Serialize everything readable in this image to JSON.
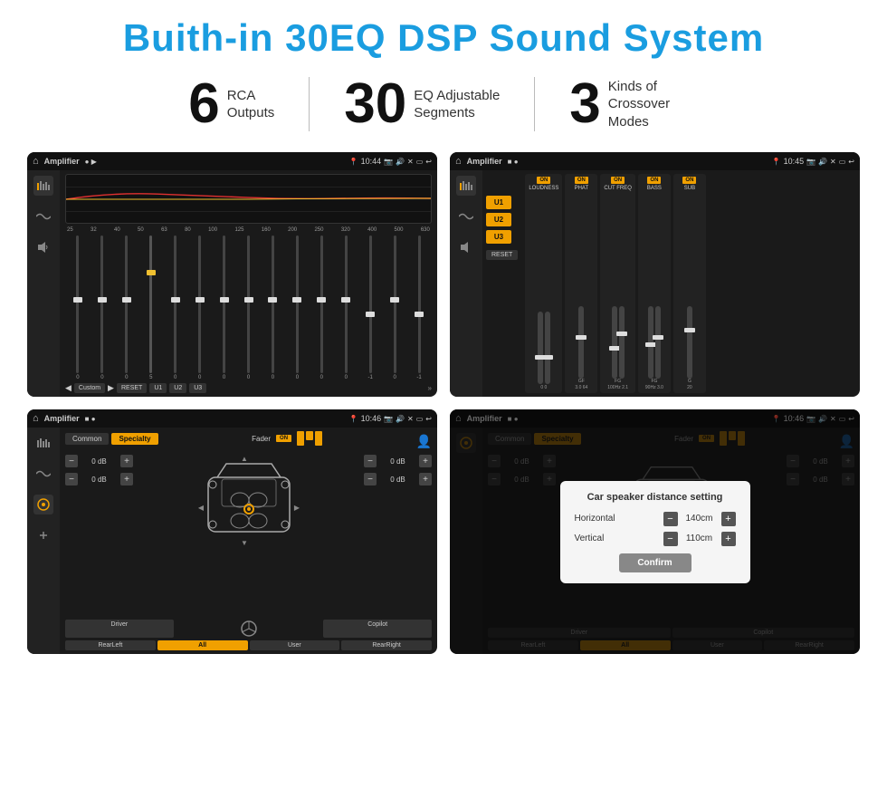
{
  "header": {
    "title": "Buith-in 30EQ DSP Sound System"
  },
  "stats": [
    {
      "number": "6",
      "label": "RCA\nOutputs"
    },
    {
      "number": "30",
      "label": "EQ Adjustable\nSegments"
    },
    {
      "number": "3",
      "label": "Kinds of\nCrossover Modes"
    }
  ],
  "screens": [
    {
      "id": "screen1",
      "status": {
        "title": "Amplifier",
        "time": "10:44"
      },
      "type": "eq"
    },
    {
      "id": "screen2",
      "status": {
        "title": "Amplifier",
        "time": "10:45"
      },
      "type": "amp"
    },
    {
      "id": "screen3",
      "status": {
        "title": "Amplifier",
        "time": "10:46"
      },
      "type": "speaker"
    },
    {
      "id": "screen4",
      "status": {
        "title": "Amplifier",
        "time": "10:46"
      },
      "type": "speaker-dialog"
    }
  ],
  "eq": {
    "frequencies": [
      "25",
      "32",
      "40",
      "50",
      "63",
      "80",
      "100",
      "125",
      "160",
      "200",
      "250",
      "320",
      "400",
      "500",
      "630"
    ],
    "values": [
      "0",
      "0",
      "0",
      "5",
      "0",
      "0",
      "0",
      "0",
      "0",
      "0",
      "0",
      "0",
      "-1",
      "0",
      "-1"
    ],
    "presets": [
      "Custom",
      "RESET",
      "U1",
      "U2",
      "U3"
    ]
  },
  "amp": {
    "u_buttons": [
      "U1",
      "U2",
      "U3"
    ],
    "controls": [
      {
        "label": "LOUDNESS",
        "on": true
      },
      {
        "label": "PHAT",
        "on": true
      },
      {
        "label": "CUT FREQ",
        "on": true
      },
      {
        "label": "BASS",
        "on": true
      },
      {
        "label": "SUB",
        "on": true
      }
    ],
    "reset_label": "RESET"
  },
  "speaker": {
    "tabs": [
      "Common",
      "Specialty"
    ],
    "active_tab": 1,
    "fader_label": "Fader",
    "fader_on": "ON",
    "controls_left": [
      "0 dB",
      "0 dB"
    ],
    "controls_right": [
      "0 dB",
      "0 dB"
    ],
    "bottom_buttons": [
      "Driver",
      "",
      "",
      "",
      "Copilot",
      "RearLeft",
      "All",
      "User",
      "RearRight"
    ]
  },
  "dialog": {
    "title": "Car speaker distance setting",
    "horizontal_label": "Horizontal",
    "horizontal_value": "140cm",
    "vertical_label": "Vertical",
    "vertical_value": "110cm",
    "confirm_label": "Confirm"
  }
}
